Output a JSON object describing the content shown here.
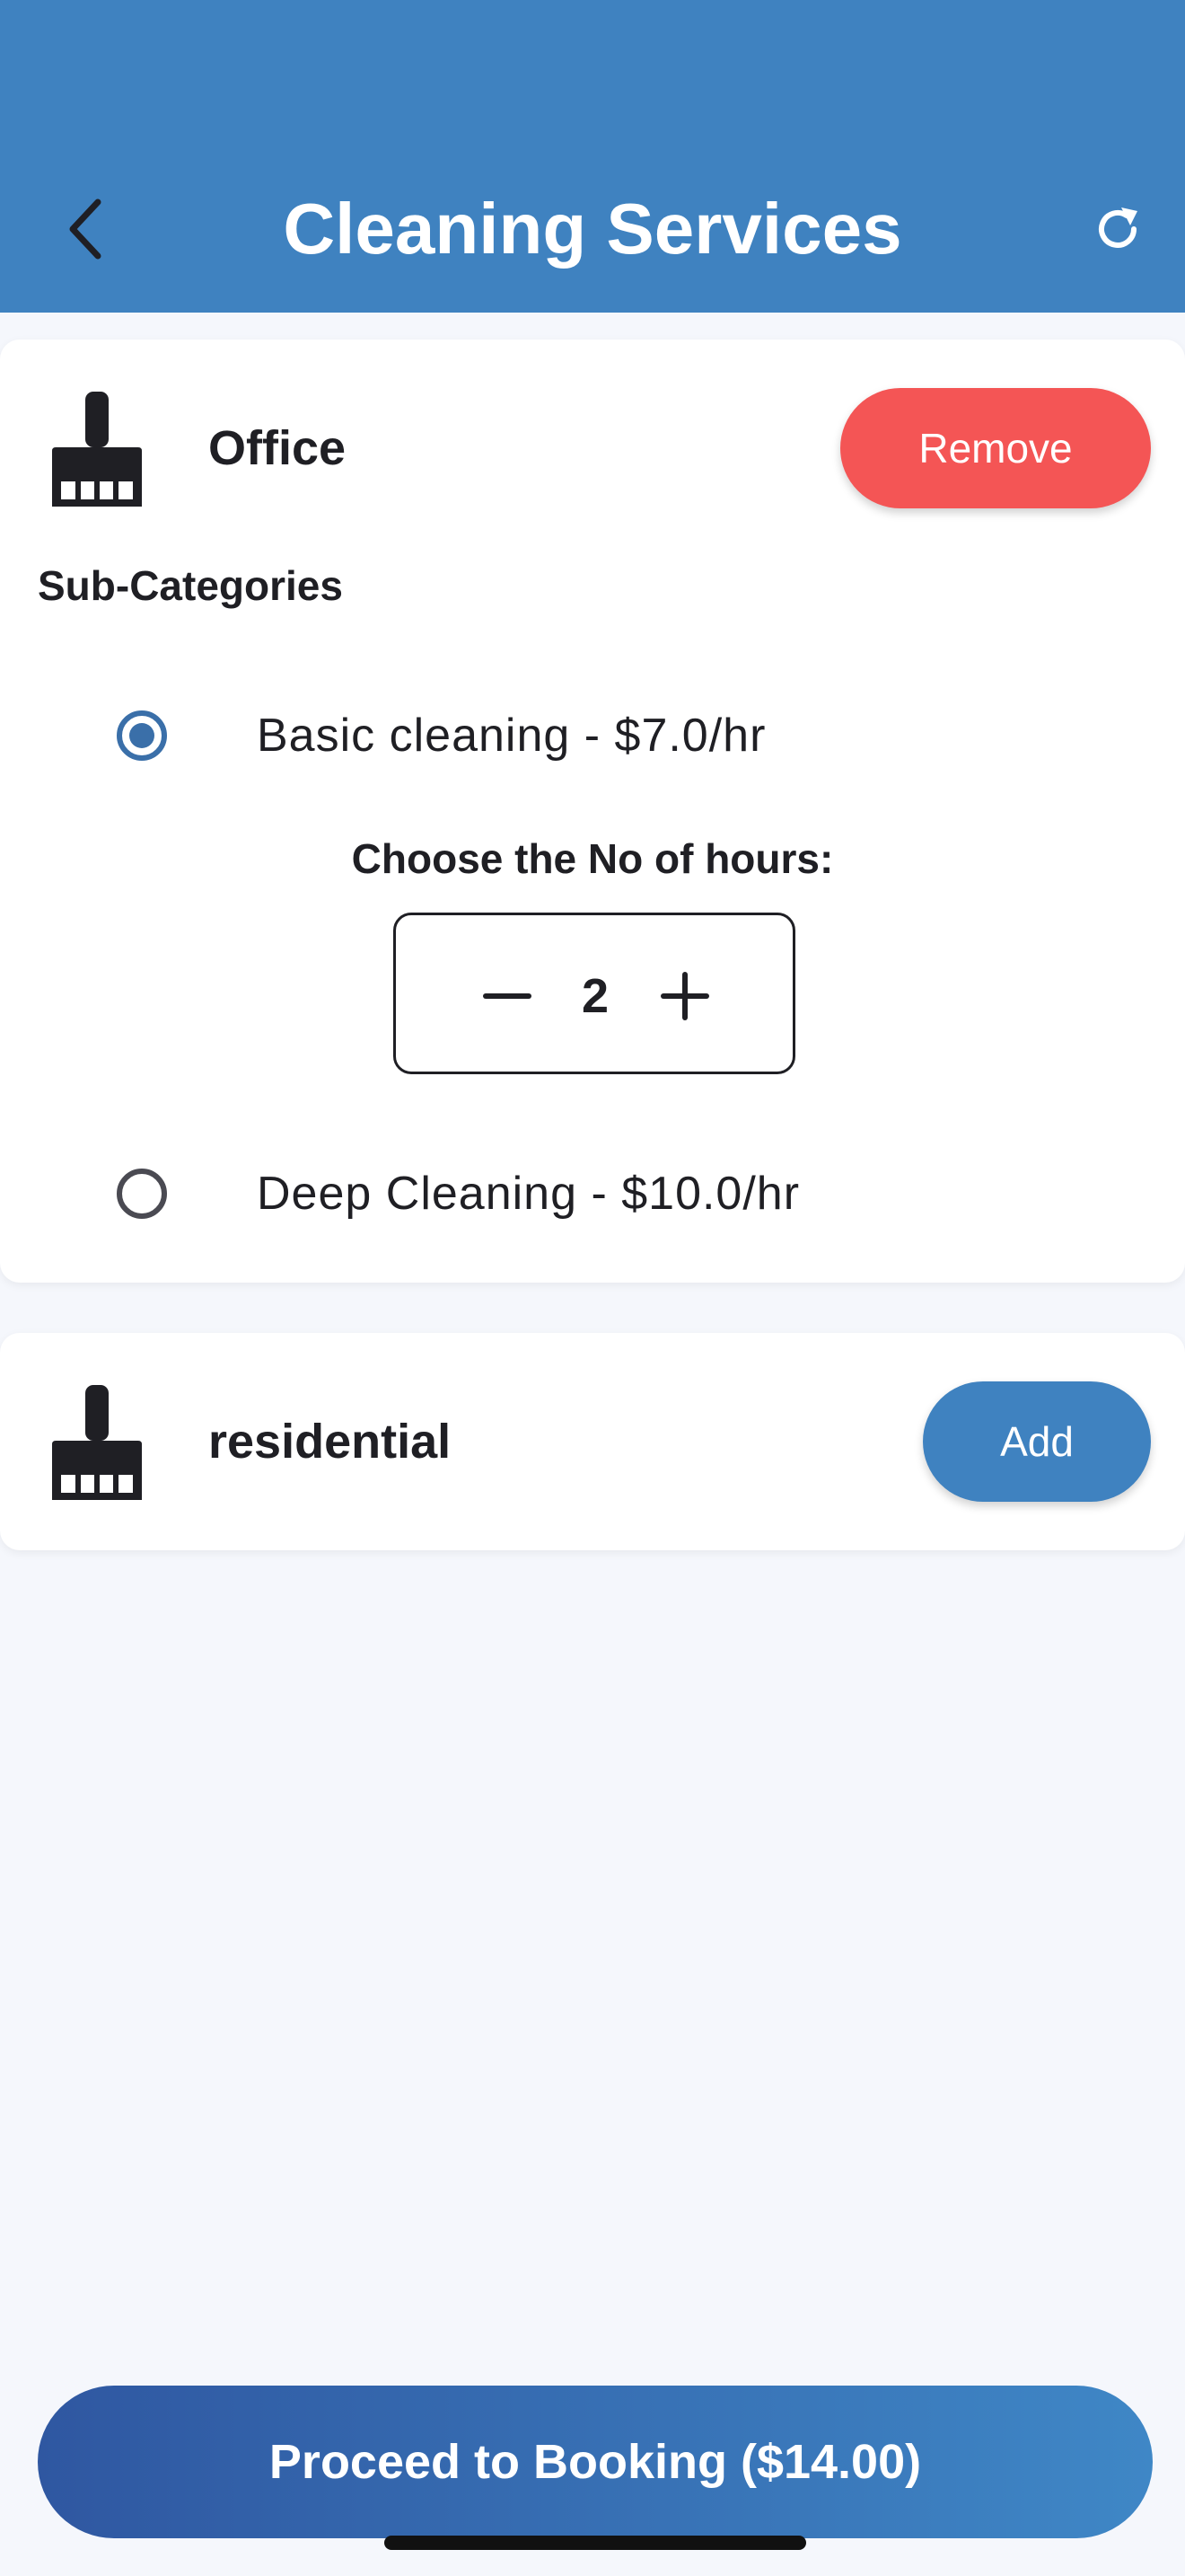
{
  "app_bar": {
    "title": "Cleaning Services",
    "background": "#3f82c0",
    "back_icon": "chevron-left-icon",
    "refresh_icon": "refresh-icon"
  },
  "categories": [
    {
      "name": "Office",
      "icon": "broom-icon",
      "action_label": "Remove",
      "action_color": "#f45555",
      "sub_categories_label": "Sub-Categories",
      "sub_categories": [
        {
          "label": "Basic cleaning - $7.0/hr",
          "selected": true
        },
        {
          "label": "Deep Cleaning - $10.0/hr",
          "selected": false
        }
      ],
      "hours_label": "Choose the No of hours:",
      "hours_value": "2"
    },
    {
      "name": "residential",
      "icon": "broom-icon",
      "action_label": "Add",
      "action_color": "#3f82c0"
    }
  ],
  "footer": {
    "proceed_label": "Proceed to Booking ($14.00)"
  }
}
